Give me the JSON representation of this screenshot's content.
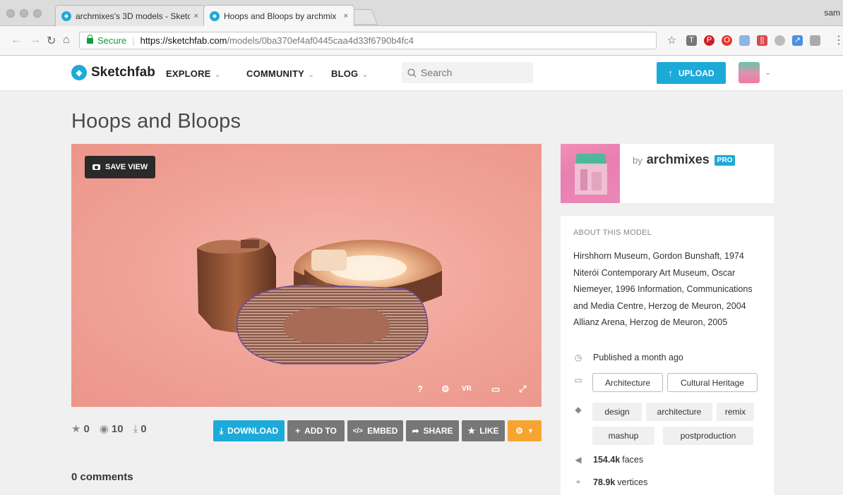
{
  "browser": {
    "tabs": [
      {
        "title": "archmixes's 3D models - Sketc",
        "close": "×"
      },
      {
        "title": "Hoops and Bloops by archmix",
        "close": "×"
      }
    ],
    "profile": "sam",
    "url": {
      "secure_label": "Secure",
      "scheme_host": "https://sketchfab.com",
      "path": "/models/0ba370ef4af0445caa4d33f6790b4fc4"
    }
  },
  "header": {
    "logo": "Sketchfab",
    "nav": [
      {
        "label": "EXPLORE"
      },
      {
        "label": "COMMUNITY"
      },
      {
        "label": "BLOG"
      }
    ],
    "search_placeholder": "Search",
    "upload_label": "UPLOAD"
  },
  "model": {
    "title": "Hoops and Bloops",
    "save_view": "SAVE VIEW",
    "viewer_controls": [
      "?",
      "⚙",
      "VR",
      "▭",
      "⤢"
    ],
    "stats": {
      "likes": "0",
      "views": "10",
      "downloads": "0"
    },
    "actions": {
      "download": "DOWNLOAD",
      "add_to": "ADD TO",
      "embed": "EMBED",
      "share": "SHARE",
      "like": "LIKE"
    },
    "comments": "0 comments"
  },
  "author": {
    "by": "by",
    "name": "archmixes",
    "badge": "PRO"
  },
  "about": {
    "heading": "ABOUT THIS MODEL",
    "description": "Hirshhorn Museum, Gordon Bunshaft, 1974 Niterói Contemporary Art Museum, Oscar Niemeyer, 1996 Information, Communications and Media Centre, Herzog de Meuron, 2004 Allianz Arena, Herzog de Meuron, 2005",
    "published": "Published a month ago",
    "categories": [
      "Architecture",
      "Cultural Heritage"
    ],
    "tags": [
      "design",
      "architecture",
      "remix",
      "mashup",
      "postproduction"
    ],
    "faces_value": "154.4k",
    "faces_label": "faces",
    "vertices_value": "78.9k",
    "vertices_label": "vertices"
  },
  "colors": {
    "accent": "#1caad9",
    "secondary_button": "#777777",
    "options_button": "#f7a531",
    "viewer_bg": "#f0a296"
  }
}
